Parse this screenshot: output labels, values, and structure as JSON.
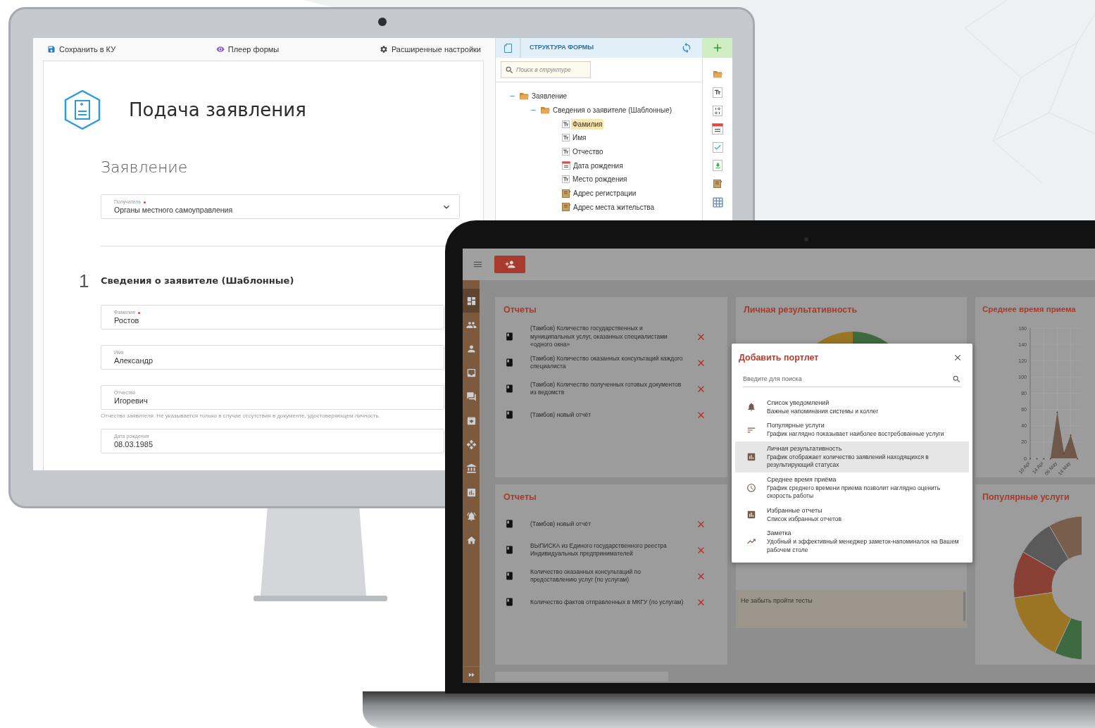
{
  "monitor": {
    "toolbar": [
      {
        "label": "Сохранить в КУ"
      },
      {
        "label": "Плеер формы"
      },
      {
        "label": "Расширенные настройки"
      }
    ],
    "form": {
      "title": "Подача заявления",
      "subtitle": "Заявление",
      "recipient": {
        "label": "Получатель",
        "required": true,
        "value": "Органы местного самоуправления"
      },
      "section": {
        "number": "1",
        "title": "Сведения о заявителе (Шаблонные)"
      },
      "fields": [
        {
          "label": "Фамилия",
          "required": true,
          "value": "Ростов"
        },
        {
          "label": "Имя",
          "required": false,
          "value": "Александр"
        },
        {
          "label": "Отчество",
          "required": false,
          "value": "Игоревич",
          "hint": "Отчество заявителя. Не указывается только в случае отсутствия в документе, удостоверяющем личность."
        },
        {
          "label": "Дата рождения",
          "required": false,
          "value": "08.03.1985"
        }
      ]
    },
    "structure": {
      "title": "СТРУКТУРА ФОРМЫ",
      "search": {
        "placeholder": "Поиск в структуре"
      },
      "tree": [
        {
          "label": "Заявление",
          "kind": "folder",
          "expanded": true,
          "selected": false,
          "children": [
            {
              "label": "Сведения о заявителе (Шаблонные)",
              "kind": "folder",
              "expanded": true,
              "selected": false,
              "children": [
                {
                  "label": "Фамилия",
                  "kind": "text",
                  "selected": true
                },
                {
                  "label": "Имя",
                  "kind": "text",
                  "selected": false
                },
                {
                  "label": "Отчество",
                  "kind": "text",
                  "selected": false
                },
                {
                  "label": "Дата рождения",
                  "kind": "date",
                  "selected": false
                },
                {
                  "label": "Место рождения",
                  "kind": "text",
                  "selected": false
                },
                {
                  "label": "Адрес регистрации",
                  "kind": "address",
                  "selected": false
                },
                {
                  "label": "Адрес места жительства",
                  "kind": "address",
                  "selected": false
                }
              ]
            }
          ]
        }
      ]
    }
  },
  "laptop": {
    "sidebar": [
      {
        "selected": true
      },
      {
        "selected": false
      },
      {
        "selected": false
      },
      {
        "selected": false
      },
      {
        "selected": false
      },
      {
        "selected": false
      },
      {
        "selected": false
      },
      {
        "selected": false
      },
      {
        "selected": false
      },
      {
        "selected": false
      },
      {
        "selected": false
      }
    ],
    "report_cards": [
      {
        "title": "Отчеты",
        "items": [
          "(Тамбов) Количество государственных и муниципальных услуг, оказанных специалистами «одного окна»",
          "(Тамбов) Количество оказанных консультаций каждого специалиста",
          "(Тамбов) Количество полученных готовых документов из ведомств",
          "(Тамбов) новый отчёт"
        ]
      },
      {
        "title": "Отчеты",
        "items": [
          "(Тамбов) новый отчёт",
          "ВЫПИСКА из Единого государственного реестра Индивидуальных предпринимателей",
          "Количество оказанных консультаций по предоставлению услуг (по услугам)",
          "Количество фактов отправленных в МКГУ (по услугам)"
        ]
      }
    ],
    "personal": {
      "title": "Личная результативность"
    },
    "note": {
      "text": "Не забыть пройти тесты"
    },
    "avg_time": {
      "title": "Среднее время приема",
      "chart_data": {
        "type": "area",
        "categories": [
          "10 Apr",
          null,
          "14 Apr",
          null,
          "06 May",
          null,
          "14 May",
          null
        ],
        "series": [
          {
            "color": "#6f574a",
            "values": [
              0,
              0,
              0,
              0,
              57,
              7,
              29,
              0
            ]
          }
        ],
        "ylim": [
          0,
          160
        ],
        "grid": true,
        "yticks": [
          0,
          20,
          40,
          60,
          80,
          100,
          120,
          140,
          160
        ]
      }
    },
    "popular": {
      "title": "Популярные услуги"
    },
    "modal": {
      "title": "Добавить портлет",
      "search": {
        "placeholder": "Введите для поиска"
      },
      "items": [
        {
          "title": "Список уведомлений",
          "description": "Важные напоминания системы и коллег",
          "selected": false
        },
        {
          "title": "Популярные услуги",
          "description": "График наглядно показывает наиболее востребованные услуги",
          "selected": false
        },
        {
          "title": "Личная результативность",
          "description": "График отображает количество заявлений находящихся в результирующий статусах",
          "selected": true
        },
        {
          "title": "Среднее время приёма",
          "description": "График среднего времени приема позволит наглядно оценить скорость работы",
          "selected": false
        },
        {
          "title": "Избранные отчеты",
          "description": "Список избранных отчетов",
          "selected": false
        },
        {
          "title": "Заметка",
          "description": "Удобный и эффективный менеджер заметок-напоминалок на Вашем рабочем столе",
          "selected": false
        }
      ]
    }
  }
}
